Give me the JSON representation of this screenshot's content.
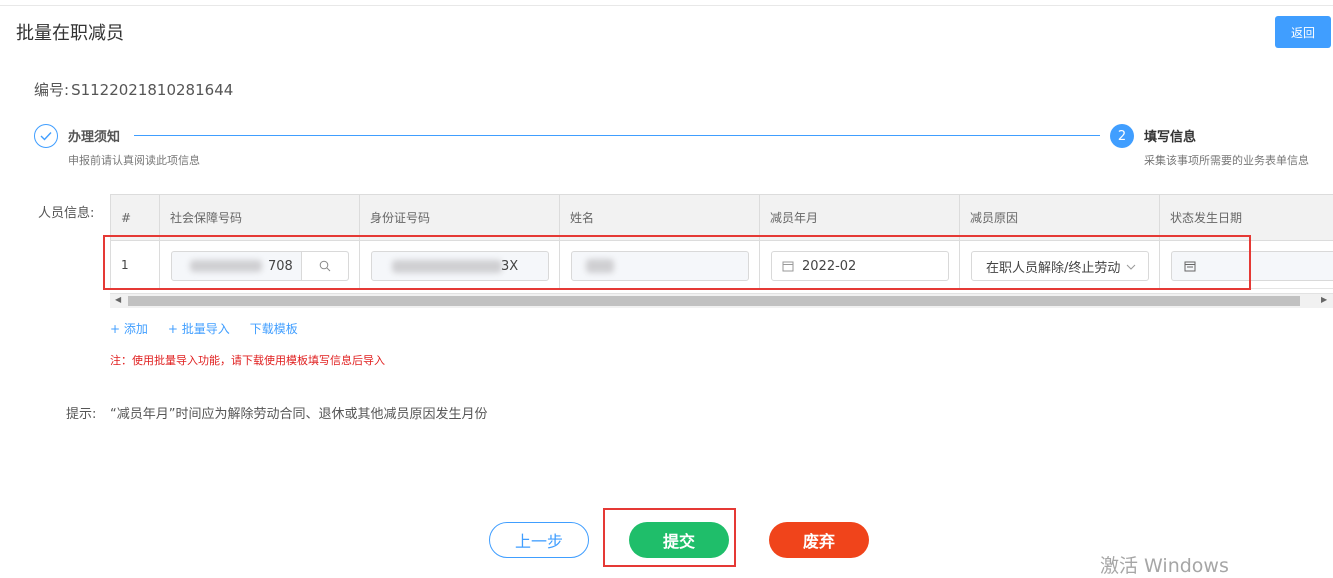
{
  "page": {
    "title": "批量在职减员",
    "back_label": "返回",
    "serial_label": "编号:",
    "serial_value": "S1122021810281644"
  },
  "steps": [
    {
      "number": "",
      "title": "办理须知",
      "desc": "申报前请认真阅读此项信息",
      "status": "done"
    },
    {
      "number": "2",
      "title": "填写信息",
      "desc": "采集该事项所需要的业务表单信息",
      "status": "active"
    }
  ],
  "form": {
    "person_label": "人员信息:"
  },
  "table": {
    "headers": [
      "#",
      "社会保障号码",
      "身份证号码",
      "姓名",
      "减员年月",
      "减员原因",
      "状态发生日期"
    ],
    "rows": [
      {
        "index": "1",
        "ss_number_suffix": "708",
        "id_number_suffix": "3X",
        "name_suffix": "",
        "month": "2022-02",
        "reason": "在职人员解除/终止劳动",
        "status_date": ""
      }
    ]
  },
  "actions": {
    "add_label": "+ 添加",
    "import_label": "+ 批量导入",
    "template_label": "下载模板"
  },
  "note": "注：使用批量导入功能，请下载使用模板填写信息后导入",
  "tip": {
    "label": "提示:",
    "text": "“减员年月”时间应为解除劳动合同、退休或其他减员原因发生月份"
  },
  "buttons": {
    "prev": "上一步",
    "submit": "提交",
    "discard": "废弃"
  },
  "watermark": "激活 Windows",
  "colors": {
    "primary": "#409eff",
    "submit": "#1fbe6a",
    "discard": "#f0441b",
    "highlight": "#e53935"
  }
}
